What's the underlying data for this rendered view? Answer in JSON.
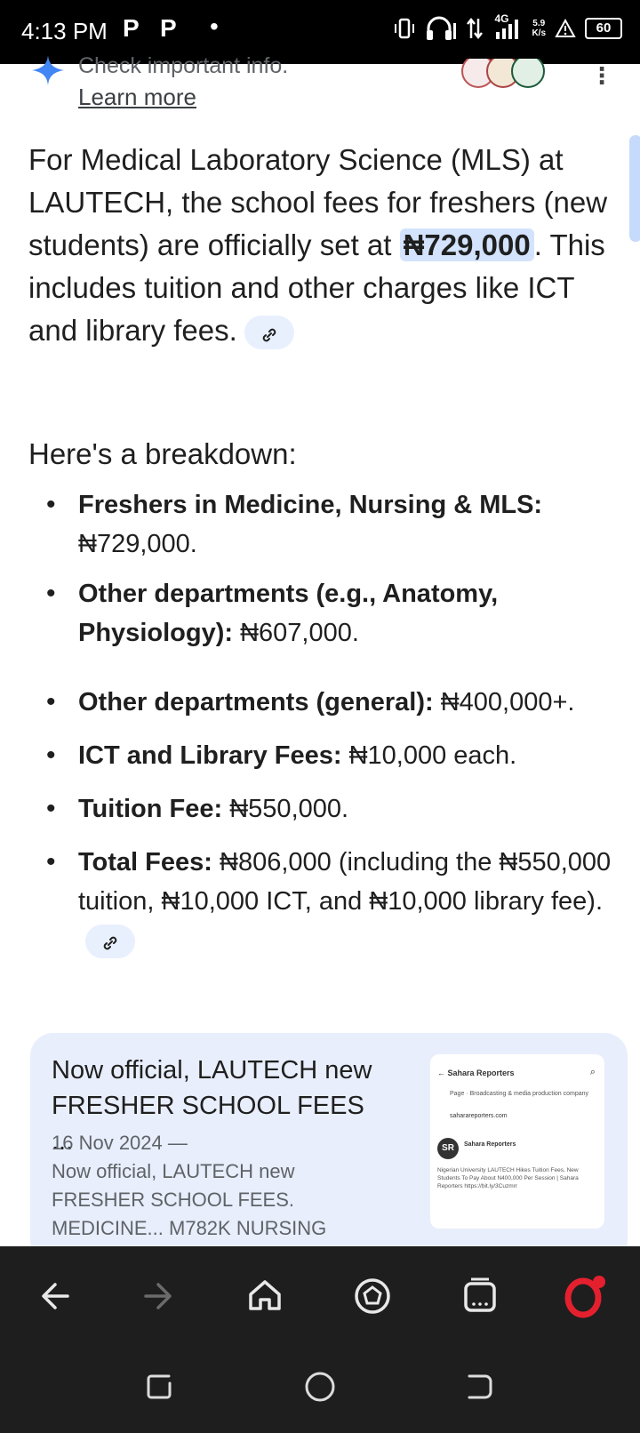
{
  "status_bar": {
    "time": "4:13 PM",
    "app_icon_1": "P",
    "app_icon_2": "P",
    "network": "4G",
    "speed_value": "5.9",
    "speed_unit": "K/s",
    "battery": "60"
  },
  "top": {
    "info_text": "Check important info.",
    "learn_more": "Learn more"
  },
  "answer": {
    "para_part1": "For Medical Laboratory Science (MLS) at LAUTECH, the school fees for freshers (new students) are officially set at ",
    "highlight": "₦729,000",
    "para_part2": ". This includes tuition and other charges like ICT and library fees.",
    "heading": "Here's a breakdown:",
    "bullets": [
      {
        "label": "Freshers in Medicine, Nursing & MLS:",
        "value": "₦729,000."
      },
      {
        "label": "Other departments (e.g., Anatomy, Physiology):",
        "value": "₦607,000."
      },
      {
        "label": "Other departments (general):",
        "value": "₦400,000+."
      },
      {
        "label": "ICT and Library Fees:",
        "value": "₦10,000 each."
      },
      {
        "label": "Tuition Fee:",
        "value": "₦550,000."
      },
      {
        "label": "Total Fees:",
        "value": "₦806,000 (including the ₦550,000 tuition, ₦10,000 ICT, and ₦10,000 library fee)."
      }
    ]
  },
  "source_card": {
    "title": "Now official, LAUTECH new FRESHER SCHOOL FEES ...",
    "date": "16 Nov 2024 —",
    "snippet": "Now official, LAUTECH new FRESHER SCHOOL FEES. MEDICINE... M782K NURSING",
    "thumb_header": "Sahara Reporters",
    "thumb_page": "Page · Broadcasting & media production company",
    "thumb_site": "saharareporters.com",
    "thumb_post_author": "Sahara Reporters",
    "thumb_post_text": "Nigerian University LAUTECH Hikes Tuition Fees, New Students To Pay About N400,000 Per Session | Sahara Reporters https://bit.ly/3Cuzmrr"
  },
  "icons": {
    "back": "back-arrow-icon",
    "forward": "forward-arrow-icon",
    "home": "home-icon",
    "speed_dial": "speed-dial-icon",
    "tabs": "tabs-icon",
    "opera": "opera-icon"
  },
  "colors": {
    "highlight_bg": "#d3e3fd",
    "card_bg": "#e8eefb",
    "bar_bg": "#1e1e1e",
    "opera_red": "#e5202e"
  }
}
